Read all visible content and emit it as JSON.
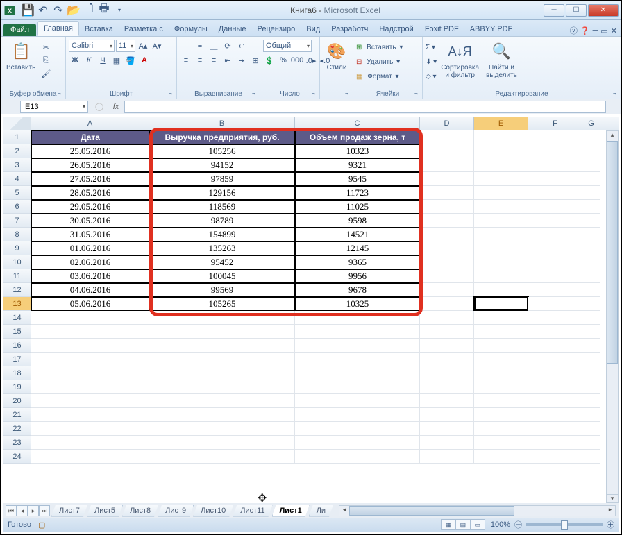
{
  "title": {
    "doc": "Книга6",
    "app": "Microsoft Excel"
  },
  "qat": [
    "save",
    "undo",
    "redo",
    "open",
    "new",
    "print"
  ],
  "tabs": {
    "file": "Файл",
    "items": [
      "Главная",
      "Вставка",
      "Разметка с",
      "Формулы",
      "Данные",
      "Рецензиро",
      "Вид",
      "Разработч",
      "Надстрой",
      "Foxit PDF",
      "ABBYY PDF"
    ],
    "active": 0
  },
  "ribbon": {
    "clipboard": {
      "title": "Буфер обмена",
      "paste": "Вставить"
    },
    "font": {
      "title": "Шрифт",
      "name": "Calibri",
      "size": "11"
    },
    "align": {
      "title": "Выравнивание"
    },
    "number": {
      "title": "Число",
      "format": "Общий"
    },
    "styles": {
      "title": "",
      "btn": "Стили"
    },
    "cells": {
      "title": "Ячейки",
      "insert": "Вставить",
      "delete": "Удалить",
      "format": "Формат"
    },
    "editing": {
      "title": "Редактирование",
      "sort": "Сортировка\nи фильтр",
      "find": "Найти и\nвыделить"
    }
  },
  "formula": {
    "ref": "E13",
    "fx": "fx",
    "value": ""
  },
  "columns": [
    "A",
    "B",
    "C",
    "D",
    "E",
    "F",
    "G"
  ],
  "headers": {
    "A": "Дата",
    "B": "Выручка предприятия, руб.",
    "C": "Объем продаж зерна, т"
  },
  "rows": [
    {
      "n": 2,
      "A": "25.05.2016",
      "B": "105256",
      "C": "10323"
    },
    {
      "n": 3,
      "A": "26.05.2016",
      "B": "94152",
      "C": "9321"
    },
    {
      "n": 4,
      "A": "27.05.2016",
      "B": "97859",
      "C": "9545"
    },
    {
      "n": 5,
      "A": "28.05.2016",
      "B": "129156",
      "C": "11723"
    },
    {
      "n": 6,
      "A": "29.05.2016",
      "B": "118569",
      "C": "11025"
    },
    {
      "n": 7,
      "A": "30.05.2016",
      "B": "98789",
      "C": "9598"
    },
    {
      "n": 8,
      "A": "31.05.2016",
      "B": "154899",
      "C": "14521"
    },
    {
      "n": 9,
      "A": "01.06.2016",
      "B": "135263",
      "C": "12145"
    },
    {
      "n": 10,
      "A": "02.06.2016",
      "B": "95452",
      "C": "9365"
    },
    {
      "n": 11,
      "A": "03.06.2016",
      "B": "100045",
      "C": "9956"
    },
    {
      "n": 12,
      "A": "04.06.2016",
      "B": "99569",
      "C": "9678"
    },
    {
      "n": 13,
      "A": "05.06.2016",
      "B": "105265",
      "C": "10325"
    }
  ],
  "empty_rows": [
    14,
    15,
    16,
    17,
    18,
    19,
    20,
    21,
    22,
    23,
    24
  ],
  "sheets": {
    "items": [
      "Лист7",
      "Лист5",
      "Лист8",
      "Лист9",
      "Лист10",
      "Лист11",
      "Лист1"
    ],
    "active": 6,
    "extra": "Ли"
  },
  "status": {
    "ready": "Готово",
    "zoom": "100%"
  },
  "active_cell": "E13"
}
